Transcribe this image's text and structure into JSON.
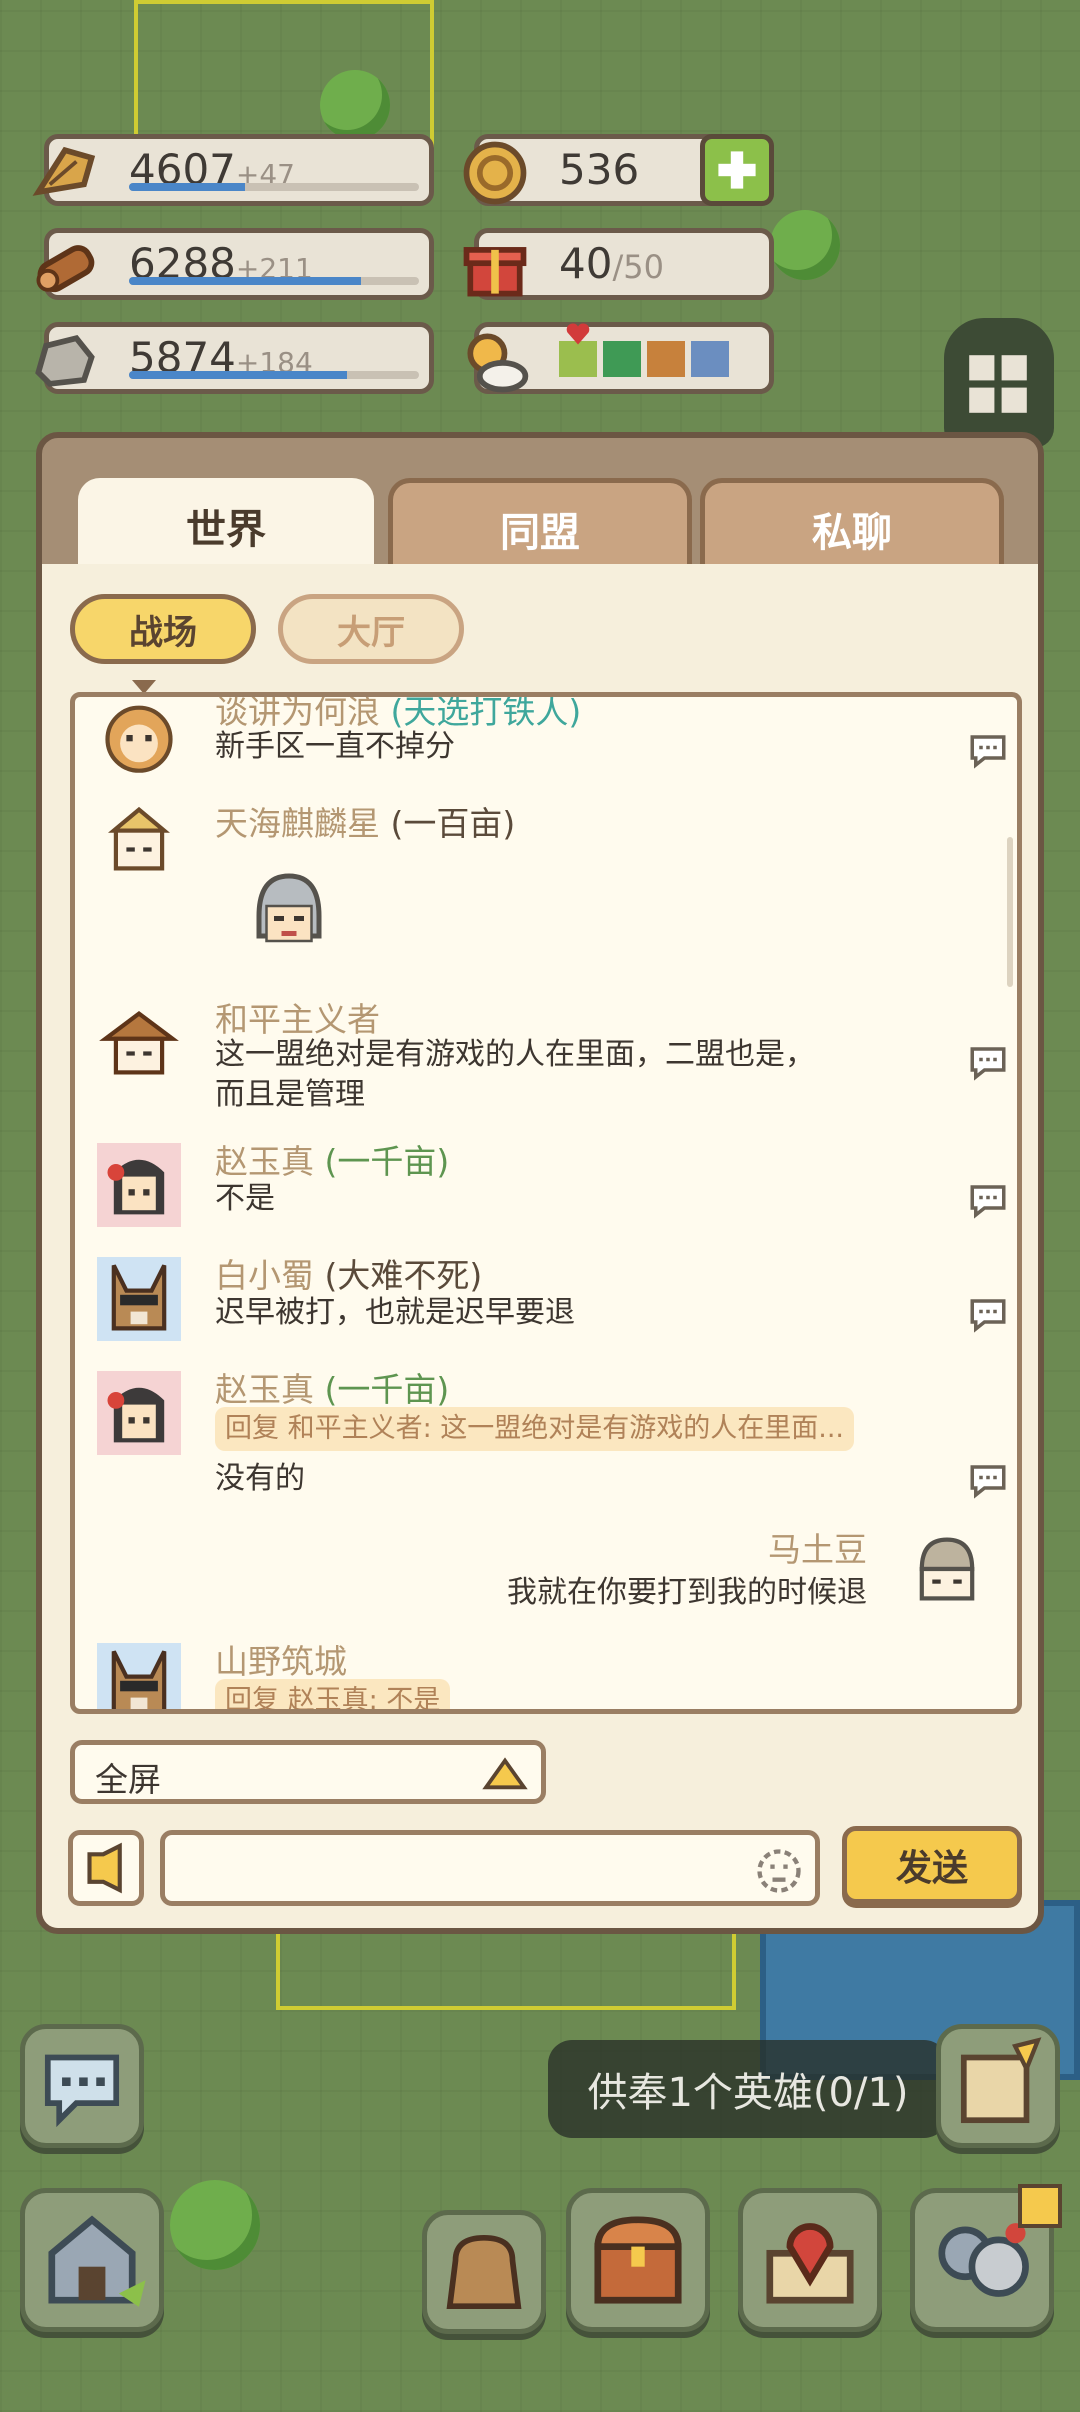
{
  "resources": {
    "grain": {
      "value": "4607",
      "inc": "+47",
      "level": 0.4
    },
    "wood": {
      "value": "6288",
      "inc": "+211",
      "level": 0.8
    },
    "stone": {
      "value": "5874",
      "inc": "+184",
      "level": 0.75
    },
    "gold": {
      "value": "536"
    },
    "gift": {
      "value": "40",
      "max": "/50"
    }
  },
  "weather_colors": [
    "#9bbe4e",
    "#3f9a55",
    "#c7813c",
    "#6b8ec0"
  ],
  "tabs": [
    {
      "label": "世界",
      "active": true
    },
    {
      "label": "同盟",
      "active": false
    },
    {
      "label": "私聊",
      "active": false
    }
  ],
  "subtabs": [
    {
      "label": "战场",
      "active": true
    },
    {
      "label": "大厅",
      "active": false
    }
  ],
  "messages": [
    {
      "name": "谈讲为何浪",
      "title": "(天选打铁人)",
      "text": "新手区一直不掉分"
    },
    {
      "name": "天海麒麟星",
      "title": "(一百亩)",
      "text": ""
    },
    {
      "name": "和平主义者",
      "title": "",
      "text_line1": "这一盟绝对是有游戏的人在里面，二盟也是，",
      "text_line2": "而且是管理"
    },
    {
      "name": "赵玉真",
      "title": "(一千亩)",
      "text": "不是"
    },
    {
      "name": "白小蜀",
      "title": "(大难不死)",
      "text": "迟早被打，也就是迟早要退"
    },
    {
      "name": "赵玉真",
      "title": "(一千亩)",
      "reply": "回复 和平主义者: 这一盟绝对是有游戏的人在里面...",
      "text": "没有的"
    },
    {
      "name": "马土豆",
      "title": "",
      "text": "我就在你要打到我的时候退"
    },
    {
      "name": "山野筑城",
      "title": "",
      "reply": "回复 赵玉真: 不是"
    }
  ],
  "fullscreen_label": "全屏",
  "input": {
    "placeholder": ""
  },
  "send_label": "发送",
  "toast": "供奉1个英雄(0/1)"
}
